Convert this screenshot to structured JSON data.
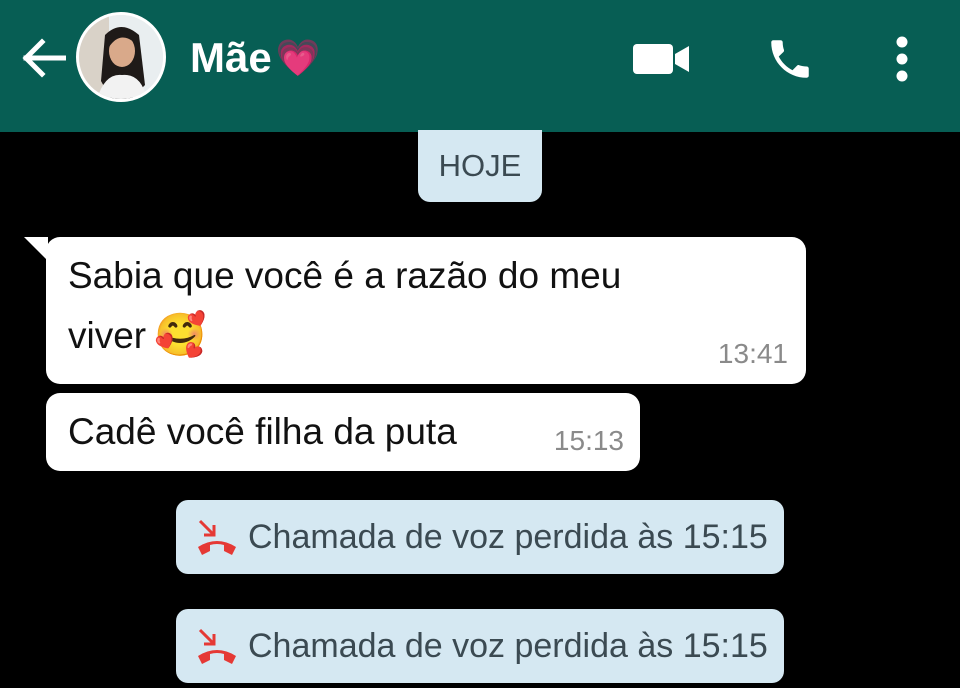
{
  "header": {
    "contact_name": "Mãe",
    "name_emoji": "💗",
    "bg_color": "#075e54",
    "icons": [
      "arrow-left-icon",
      "video-call-icon",
      "phone-icon",
      "more-vert-icon"
    ]
  },
  "chat": {
    "date_label": "HOJE",
    "messages": [
      {
        "text_line1": "Sabia que você é a razão do meu",
        "text_line2": "viver",
        "emoji": "🥰",
        "time": "13:41"
      },
      {
        "text": "Cadê você filha da puta",
        "time": "15:13"
      }
    ],
    "missed_calls": [
      {
        "text": "Chamada de voz perdida às 15:15"
      },
      {
        "text": "Chamada de voz perdida às 15:15"
      }
    ]
  },
  "colors": {
    "header": "#075e54",
    "chat_bg": "#000000",
    "bubble": "#ffffff",
    "system_pill": "#d5e8f2",
    "missed_call_icon": "#e53935"
  }
}
